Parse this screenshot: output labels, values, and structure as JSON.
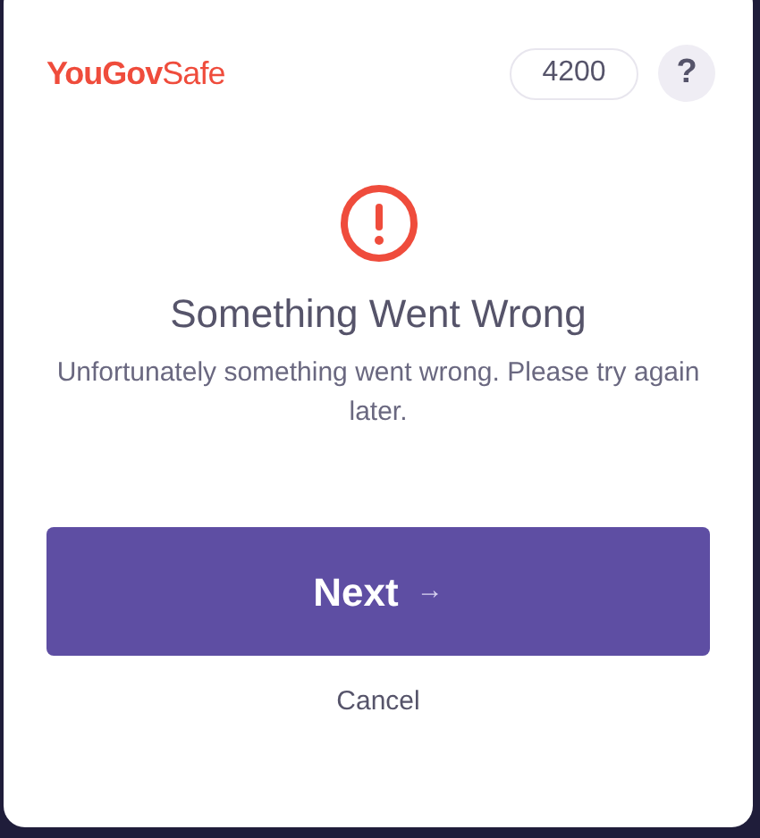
{
  "header": {
    "logo": "**YouGov**Safe",
    "points": "4200",
    "help": "?"
  },
  "error": {
    "title": "Something Went Wrong",
    "message": "Unfortunately something went wrong. Please try again later."
  },
  "primary_button": {
    "label": "Next",
    "arrow": "→"
  },
  "cancel_link": "Cancel"
}
